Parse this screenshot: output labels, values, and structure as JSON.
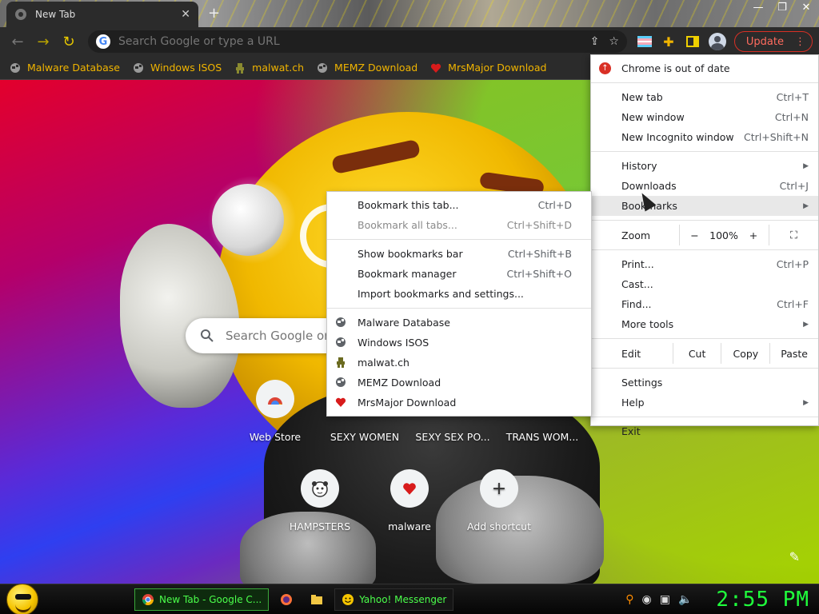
{
  "browser": {
    "tab_title": "New Tab",
    "omnibox_placeholder": "Search Google or type a URL",
    "update_label": "Update"
  },
  "bookmarks_bar": [
    {
      "label": "Malware Database",
      "icon": "globe-icon"
    },
    {
      "label": "Windows ISOS",
      "icon": "globe-icon"
    },
    {
      "label": "malwat.ch",
      "icon": "figure-icon"
    },
    {
      "label": "MEMZ Download",
      "icon": "globe-icon"
    },
    {
      "label": "MrsMajor Download",
      "icon": "heart-icon"
    }
  ],
  "ntp": {
    "search_placeholder": "Search Google or type a URL",
    "shortcuts_row1": [
      {
        "label": "Web Store"
      },
      {
        "label": "SEXY WOMEN"
      },
      {
        "label": "SEXY SEX PO..."
      },
      {
        "label": "TRANS WOM..."
      }
    ],
    "shortcuts_row2": [
      {
        "label": "HAMPSTERS"
      },
      {
        "label": "malware"
      },
      {
        "label": "Add shortcut"
      }
    ]
  },
  "menu": {
    "update_notice": "Chrome is out of date",
    "new_tab": {
      "label": "New tab",
      "shortcut": "Ctrl+T"
    },
    "new_window": {
      "label": "New window",
      "shortcut": "Ctrl+N"
    },
    "new_incognito": {
      "label": "New Incognito window",
      "shortcut": "Ctrl+Shift+N"
    },
    "history": {
      "label": "History"
    },
    "downloads": {
      "label": "Downloads",
      "shortcut": "Ctrl+J"
    },
    "bookmarks": {
      "label": "Bookmarks"
    },
    "zoom": {
      "label": "Zoom",
      "minus": "−",
      "value": "100%",
      "plus": "+"
    },
    "print": {
      "label": "Print...",
      "shortcut": "Ctrl+P"
    },
    "cast": {
      "label": "Cast..."
    },
    "find": {
      "label": "Find...",
      "shortcut": "Ctrl+F"
    },
    "more_tools": {
      "label": "More tools"
    },
    "edit": {
      "label": "Edit",
      "cut": "Cut",
      "copy": "Copy",
      "paste": "Paste"
    },
    "settings": {
      "label": "Settings"
    },
    "help": {
      "label": "Help"
    },
    "exit": {
      "label": "Exit"
    }
  },
  "bookmarks_submenu": {
    "bookmark_tab": {
      "label": "Bookmark this tab...",
      "shortcut": "Ctrl+D"
    },
    "bookmark_all": {
      "label": "Bookmark all tabs...",
      "shortcut": "Ctrl+Shift+D"
    },
    "show_bar": {
      "label": "Show bookmarks bar",
      "shortcut": "Ctrl+Shift+B"
    },
    "manager": {
      "label": "Bookmark manager",
      "shortcut": "Ctrl+Shift+O"
    },
    "import": {
      "label": "Import bookmarks and settings..."
    },
    "items": [
      {
        "label": "Malware Database"
      },
      {
        "label": "Windows ISOS"
      },
      {
        "label": "malwat.ch"
      },
      {
        "label": "MEMZ Download"
      },
      {
        "label": "MrsMajor Download"
      }
    ]
  },
  "taskbar": {
    "tasks": [
      {
        "label": "New Tab - Google C..."
      },
      {
        "label": "Yahoo! Messenger"
      }
    ],
    "clock": "2:55 PM"
  }
}
